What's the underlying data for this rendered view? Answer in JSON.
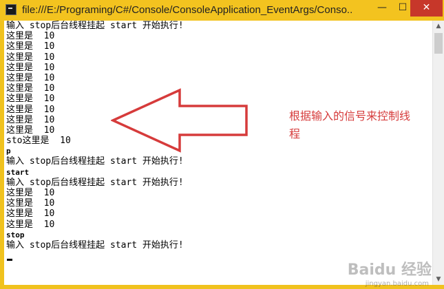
{
  "window": {
    "title": "file:///E:/Programing/C#/Console/ConsoleApplication_EventArgs/Conso...",
    "minimize_glyph": "—",
    "maximize_glyph": "☐",
    "close_glyph": "✕",
    "accent_color": "#f3c31f",
    "close_color": "#c7372a"
  },
  "console": {
    "lines": [
      "输入 stop后台线程挂起 start 开始执行!",
      "这里是  10",
      "这里是  10",
      "这里是  10",
      "这里是  10",
      "这里是  10",
      "这里是  10",
      "这里是  10",
      "这里是  10",
      "这里是  10",
      "这里是  10",
      "sto这里是  10",
      "p",
      "输入 stop后台线程挂起 start 开始执行!",
      "start",
      "输入 stop后台线程挂起 start 开始执行!",
      "这里是  10",
      "这里是  10",
      "这里是  10",
      "这里是  10",
      "stop",
      "输入 stop后台线程挂起 start 开始执行!"
    ]
  },
  "annotation": {
    "text": "根据输入的信号来控制线程",
    "color": "#d63b3b"
  },
  "scrollbar": {
    "up_glyph": "▲",
    "down_glyph": "▼"
  },
  "watermark": {
    "brand": "Baidu 经验",
    "site": "jingyan.baidu.com"
  }
}
